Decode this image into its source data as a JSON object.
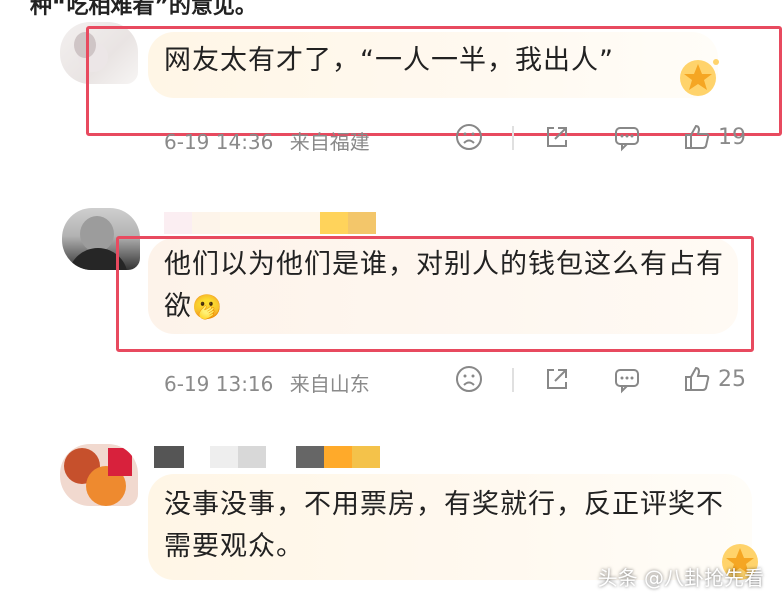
{
  "header": {
    "cut_text": "种“吃相难看”的意见。"
  },
  "comments": [
    {
      "text": "网友太有才了，“一人一半，我出人”",
      "date": "6-19 14:36",
      "location": "来自福建",
      "like_count": "19"
    },
    {
      "text": "他们以为他们是谁，对别人的钱包这么有占有欲",
      "emoji": "🫢",
      "date": "6-19 13:16",
      "location": "来自山东",
      "like_count": "25"
    },
    {
      "text": "没事没事，不用票房，有奖就行，反正评奖不需要观众。"
    }
  ],
  "watermark": "头条 @八卦抢先看",
  "colors": {
    "highlight": "#e84a5f",
    "bubble": "#fff6e6",
    "meta": "#8a8a8a"
  }
}
